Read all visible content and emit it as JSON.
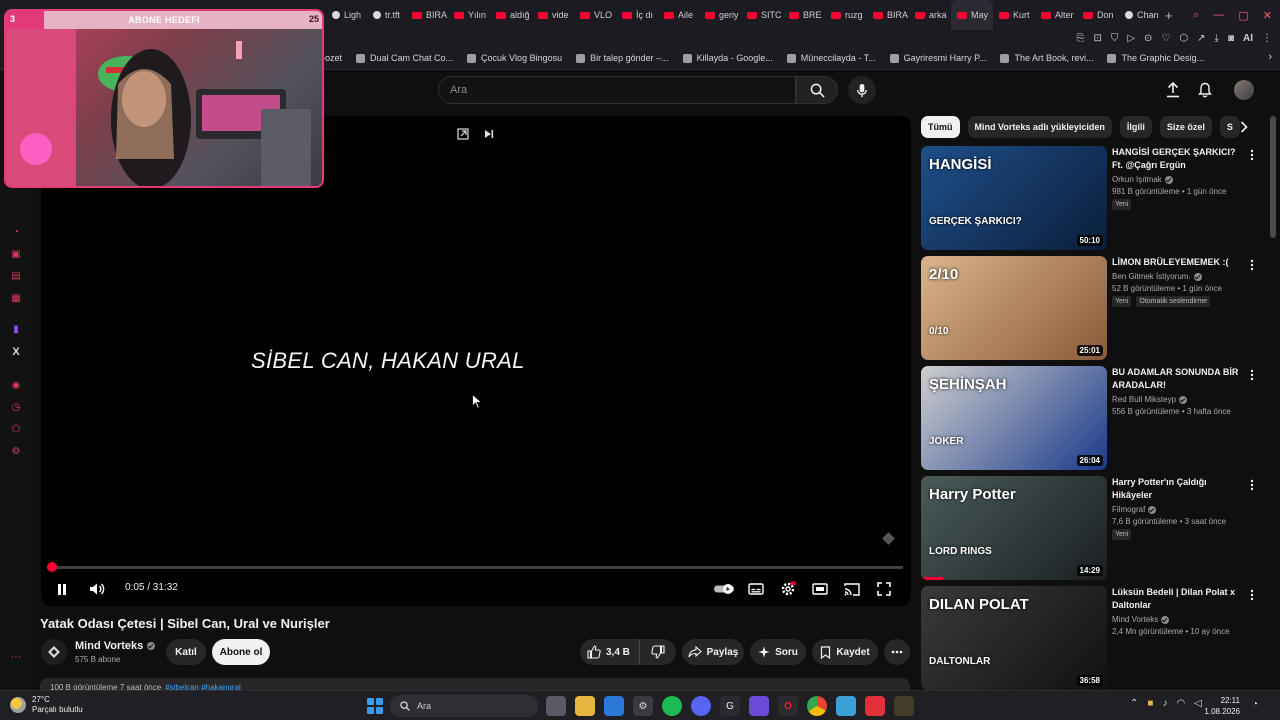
{
  "browser": {
    "tabs": [
      {
        "label": "Ligh",
        "icon": "opera-icon"
      },
      {
        "label": "tr.tft",
        "icon": "globe-icon"
      },
      {
        "label": "BIRA",
        "icon": "youtube-icon"
      },
      {
        "label": "Yılın",
        "icon": "youtube-icon"
      },
      {
        "label": "aldığ",
        "icon": "youtube-icon"
      },
      {
        "label": "vide",
        "icon": "youtube-icon"
      },
      {
        "label": "VLO",
        "icon": "youtube-icon"
      },
      {
        "label": "İç dı",
        "icon": "youtube-icon"
      },
      {
        "label": "Aile",
        "icon": "youtube-icon"
      },
      {
        "label": "geriy",
        "icon": "youtube-icon"
      },
      {
        "label": "SITC",
        "icon": "youtube-icon"
      },
      {
        "label": "BRE",
        "icon": "youtube-icon"
      },
      {
        "label": "ruzg",
        "icon": "youtube-icon"
      },
      {
        "label": "BIRA",
        "icon": "youtube-icon"
      },
      {
        "label": "arka",
        "icon": "youtube-icon"
      },
      {
        "label": "May",
        "icon": "youtube-icon",
        "active": true
      },
      {
        "label": "Kurt",
        "icon": "youtube-icon"
      },
      {
        "label": "Alter",
        "icon": "youtube-icon"
      },
      {
        "label": "Don",
        "icon": "youtube-icon"
      },
      {
        "label": "Chan",
        "icon": "chrome-icon"
      }
    ],
    "new_tab": "+",
    "bookmarks": [
      {
        "label": "-ozet"
      },
      {
        "label": "Dual Cam Chat Co..."
      },
      {
        "label": "Çocuk Vlog Bingosu"
      },
      {
        "label": "Bir talep gönder –..."
      },
      {
        "label": "Killayda - Google..."
      },
      {
        "label": "Müneccilayda - T..."
      },
      {
        "label": "Gayriresmi Harry P..."
      },
      {
        "label": "The Art Book, revi..."
      },
      {
        "label": "The Graphic Desig..."
      }
    ],
    "ext_ai": "AI"
  },
  "overlay": {
    "label": "ABONE HEDEFI",
    "current": "3",
    "goal": "25",
    "progress": 0.12
  },
  "youtube": {
    "search_placeholder": "Ara"
  },
  "player": {
    "subtitle": "SİBEL CAN, HAKAN URAL",
    "time": "0:05 / 31:32",
    "progress": 0.003
  },
  "video": {
    "title": "Yatak Odası Çetesi | Sibel Can, Ural ve Nurişler",
    "channel": "Mind Vorteks",
    "subscribers": "575 B abone",
    "join": "Katıl",
    "subscribe": "Abone ol",
    "likes": "3,4 B",
    "share": "Paylaş",
    "ask": "Soru",
    "save": "Kaydet",
    "desc_prefix": "100 B görüntüleme  7 saat önce",
    "desc_tags": "#sibelcan #hakanural"
  },
  "chips": [
    {
      "label": "Tümü",
      "active": true
    },
    {
      "label": "Mind Vorteks adlı yükleyiciden"
    },
    {
      "label": "İlgili"
    },
    {
      "label": "Size özel"
    },
    {
      "label": "S"
    }
  ],
  "recommendations": [
    {
      "title": "HANGİSİ GERÇEK ŞARKICI? Ft. @Çağrı Ergün",
      "channel": "Orkun Işıtmak",
      "meta": "981 B görüntüleme • 1 gün önce",
      "badges": [
        "Yeni"
      ],
      "duration": "50:10",
      "thumb_text": "HANGİSİ",
      "thumb_sub": "GERÇEK ŞARKICI?",
      "colors": [
        "#1f4f8a",
        "#0a1e3a"
      ]
    },
    {
      "title": "LİMON BRÜLEYEMEMEK :(",
      "channel": "Ben Gitmek İstiyorum.",
      "meta": "52 B görüntüleme • 1 gün önce",
      "badges": [
        "Yeni",
        "Otomatik seslendirme"
      ],
      "duration": "25:01",
      "thumb_text": "2/10",
      "thumb_sub": "0/10",
      "colors": [
        "#d9b48a",
        "#8a5a3a"
      ]
    },
    {
      "title": "BU ADAMLAR SONUNDA BİR ARADALAR!",
      "channel": "Red Bull Miksteyp",
      "meta": "556 B görüntüleme • 3 hafta önce",
      "badges": [],
      "duration": "26:04",
      "thumb_text": "ŞEHİNŞAH",
      "thumb_sub": "JOKER",
      "colors": [
        "#cfcfcf",
        "#1a3a8a"
      ]
    },
    {
      "title": "Harry Potter'ın Çaldığı Hikâyeler",
      "channel": "Filmograf",
      "meta": "7,6 B görüntüleme • 3 saat önce",
      "badges": [
        "Yeni"
      ],
      "duration": "14:29",
      "thumb_text": "Harry Potter",
      "thumb_sub": "LORD RINGS",
      "colors": [
        "#4a5a5a",
        "#1a1f22"
      ],
      "watched": 0.12
    },
    {
      "title": "Lüksün Bedeli | Dilan Polat x Daltonlar",
      "channel": "Mind Vorteks",
      "meta": "2,4 Mn görüntüleme • 10 ay önce",
      "badges": [],
      "duration": "36:58",
      "thumb_text": "DILAN POLAT",
      "thumb_sub": "DALTONLAR",
      "colors": [
        "#3a3a3a",
        "#111111"
      ]
    }
  ],
  "taskbar": {
    "temp": "27°C",
    "weather": "Parçalı bulutlu",
    "search": "Ara",
    "time": "22:11",
    "date": "1.08.2026"
  },
  "colors": {
    "accent": "#ff0033",
    "overlay_pink": "#e23a78"
  }
}
